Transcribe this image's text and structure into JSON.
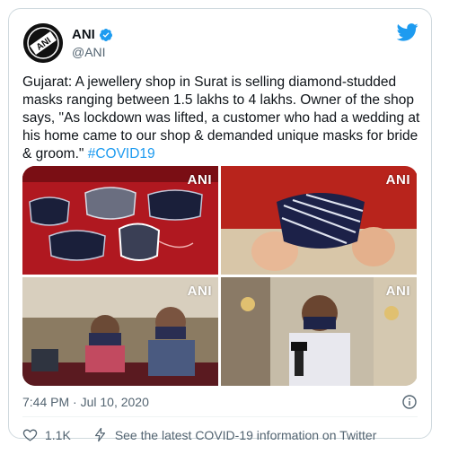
{
  "author": {
    "name": "ANI",
    "handle": "@ANI",
    "avatar_text": "ANI"
  },
  "tweet": {
    "text": "Gujarat: A jewellery shop in Surat is selling diamond-studded masks ranging between 1.5 lakhs to 4 lakhs. Owner of the shop says, \"As lockdown was lifted, a customer who had a wedding at his home came to our shop & demanded unique masks for bride & groom.\" ",
    "hashtag": "#COVID19"
  },
  "media": [
    {
      "watermark": "ANI"
    },
    {
      "watermark": "ANI"
    },
    {
      "watermark": "ANI"
    },
    {
      "watermark": "ANI"
    }
  ],
  "meta": {
    "timestamp": "7:44 PM · Jul 10, 2020"
  },
  "actions": {
    "like_count": "1.1K",
    "covid_info": "See the latest COVID-19 information on Twitter"
  },
  "colors": {
    "twitter_blue": "#1d9bf0",
    "text_primary": "#0f1419",
    "text_secondary": "#536471",
    "border": "#cfd9de"
  }
}
